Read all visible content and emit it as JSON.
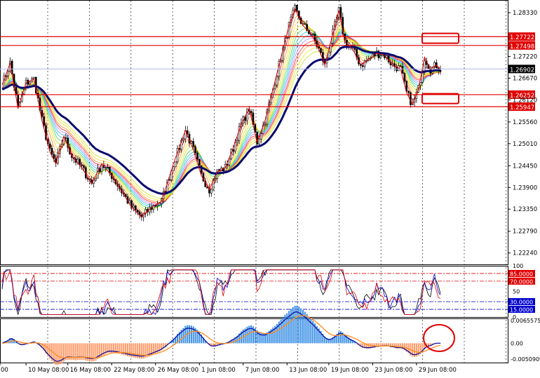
{
  "chart_data": [
    {
      "type": "candlestick",
      "panel": "main",
      "instrument": "",
      "y_ticks": [
        1.2833,
        1.27775,
        1.2722,
        1.2667,
        1.2612,
        1.2556,
        1.2501,
        1.2445,
        1.239,
        1.2335,
        1.2279,
        1.2224
      ],
      "ylim": [
        1.2195,
        1.2865
      ],
      "grid": true,
      "current_price": {
        "value": 1.26902,
        "label": "1.26902"
      },
      "horizontal_levels": [
        {
          "value": 1.27722,
          "label": "1.27722",
          "color": "#e00000"
        },
        {
          "value": 1.27498,
          "label": "1.27498",
          "color": "#e00000"
        },
        {
          "value": 1.26252,
          "label": "1.26252",
          "color": "#e00000"
        },
        {
          "value": 1.25947,
          "label": "1.25947",
          "color": "#e00000"
        }
      ],
      "annotations": [
        {
          "shape": "rounded-rect",
          "color": "#e00000",
          "near_value": 1.2768
        },
        {
          "shape": "rounded-rect",
          "color": "#e00000",
          "near_value": 1.2615
        }
      ],
      "zigzag_color": "#e00000",
      "slow_ma_color": "#0a0a6e",
      "ribbon_colors": [
        "#ff0000",
        "#ff7f00",
        "#ffd400",
        "#b8e000",
        "#33cc33",
        "#00c8c8",
        "#33a0ff",
        "#b070ff"
      ],
      "price_path": [
        {
          "t": 0,
          "p": 1.265
        },
        {
          "t": 4,
          "p": 1.2705
        },
        {
          "t": 8,
          "p": 1.259
        },
        {
          "t": 12,
          "p": 1.2655
        },
        {
          "t": 16,
          "p": 1.2665
        },
        {
          "t": 20,
          "p": 1.256
        },
        {
          "t": 24,
          "p": 1.248
        },
        {
          "t": 27,
          "p": 1.245
        },
        {
          "t": 31,
          "p": 1.252
        },
        {
          "t": 35,
          "p": 1.247
        },
        {
          "t": 40,
          "p": 1.244
        },
        {
          "t": 45,
          "p": 1.24
        },
        {
          "t": 50,
          "p": 1.245
        },
        {
          "t": 55,
          "p": 1.242
        },
        {
          "t": 60,
          "p": 1.238
        },
        {
          "t": 65,
          "p": 1.234
        },
        {
          "t": 70,
          "p": 1.2315
        },
        {
          "t": 75,
          "p": 1.234
        },
        {
          "t": 80,
          "p": 1.2355
        },
        {
          "t": 86,
          "p": 1.245
        },
        {
          "t": 92,
          "p": 1.2535
        },
        {
          "t": 96,
          "p": 1.2485
        },
        {
          "t": 100,
          "p": 1.242
        },
        {
          "t": 104,
          "p": 1.2385
        },
        {
          "t": 108,
          "p": 1.243
        },
        {
          "t": 112,
          "p": 1.244
        },
        {
          "t": 116,
          "p": 1.249
        },
        {
          "t": 120,
          "p": 1.255
        },
        {
          "t": 124,
          "p": 1.259
        },
        {
          "t": 128,
          "p": 1.2505
        },
        {
          "t": 132,
          "p": 1.256
        },
        {
          "t": 136,
          "p": 1.264
        },
        {
          "t": 140,
          "p": 1.272
        },
        {
          "t": 144,
          "p": 1.28
        },
        {
          "t": 147,
          "p": 1.2842
        },
        {
          "t": 151,
          "p": 1.28
        },
        {
          "t": 155,
          "p": 1.278
        },
        {
          "t": 159,
          "p": 1.274
        },
        {
          "t": 162,
          "p": 1.27
        },
        {
          "t": 166,
          "p": 1.278
        },
        {
          "t": 169,
          "p": 1.2838
        },
        {
          "t": 172,
          "p": 1.276
        },
        {
          "t": 176,
          "p": 1.274
        },
        {
          "t": 180,
          "p": 1.27
        },
        {
          "t": 184,
          "p": 1.2715
        },
        {
          "t": 188,
          "p": 1.273
        },
        {
          "t": 192,
          "p": 1.2725
        },
        {
          "t": 196,
          "p": 1.27
        },
        {
          "t": 200,
          "p": 1.269
        },
        {
          "t": 203,
          "p": 1.263
        },
        {
          "t": 206,
          "p": 1.26
        },
        {
          "t": 209,
          "p": 1.264
        },
        {
          "t": 212,
          "p": 1.272
        },
        {
          "t": 215,
          "p": 1.269
        },
        {
          "t": 218,
          "p": 1.27
        },
        {
          "t": 220,
          "p": 1.269
        }
      ]
    },
    {
      "type": "line",
      "panel": "oscillator",
      "ylim": [
        0,
        100
      ],
      "y_ticks": [
        100,
        50,
        0
      ],
      "levels": [
        {
          "value": 85,
          "label": "85.0000",
          "color": "#e00000"
        },
        {
          "value": 70,
          "label": "70.0000",
          "color": "#e00000"
        },
        {
          "value": 30,
          "label": "30.0000",
          "color": "#0000cc"
        },
        {
          "value": 15,
          "label": "15.0000",
          "color": "#0000cc"
        }
      ],
      "series_colors": [
        "#000000",
        "#0000cc",
        "#e00000"
      ]
    },
    {
      "type": "bar",
      "panel": "macd",
      "y_ticks_labels": [
        "0.0065575",
        "0.00",
        "-0.0050909"
      ],
      "ylim": [
        -0.0050909,
        0.0065575
      ],
      "histogram_positive_color": "#3a8fe6",
      "histogram_negative_color": "#ff9966",
      "signal_line_color": "#ff8c1a",
      "macd_line_color": "#1010a0",
      "highlight": {
        "shape": "ellipse",
        "color": "#e00000"
      }
    }
  ],
  "x_axis": {
    "tick_labels": [
      "00",
      "10 May 08:00",
      "16 May 08:00",
      "22 May 08:00",
      "26 May 08:00",
      "1 Jun 08:00",
      "7 Jun 08:00",
      "13 Jun 08:00",
      "19 Jun 08:00",
      "23 Jun 08:00",
      "29 Jun 08:00"
    ],
    "tick_index": [
      0,
      12,
      33,
      55,
      77,
      99,
      121,
      143,
      164,
      186,
      208
    ]
  }
}
